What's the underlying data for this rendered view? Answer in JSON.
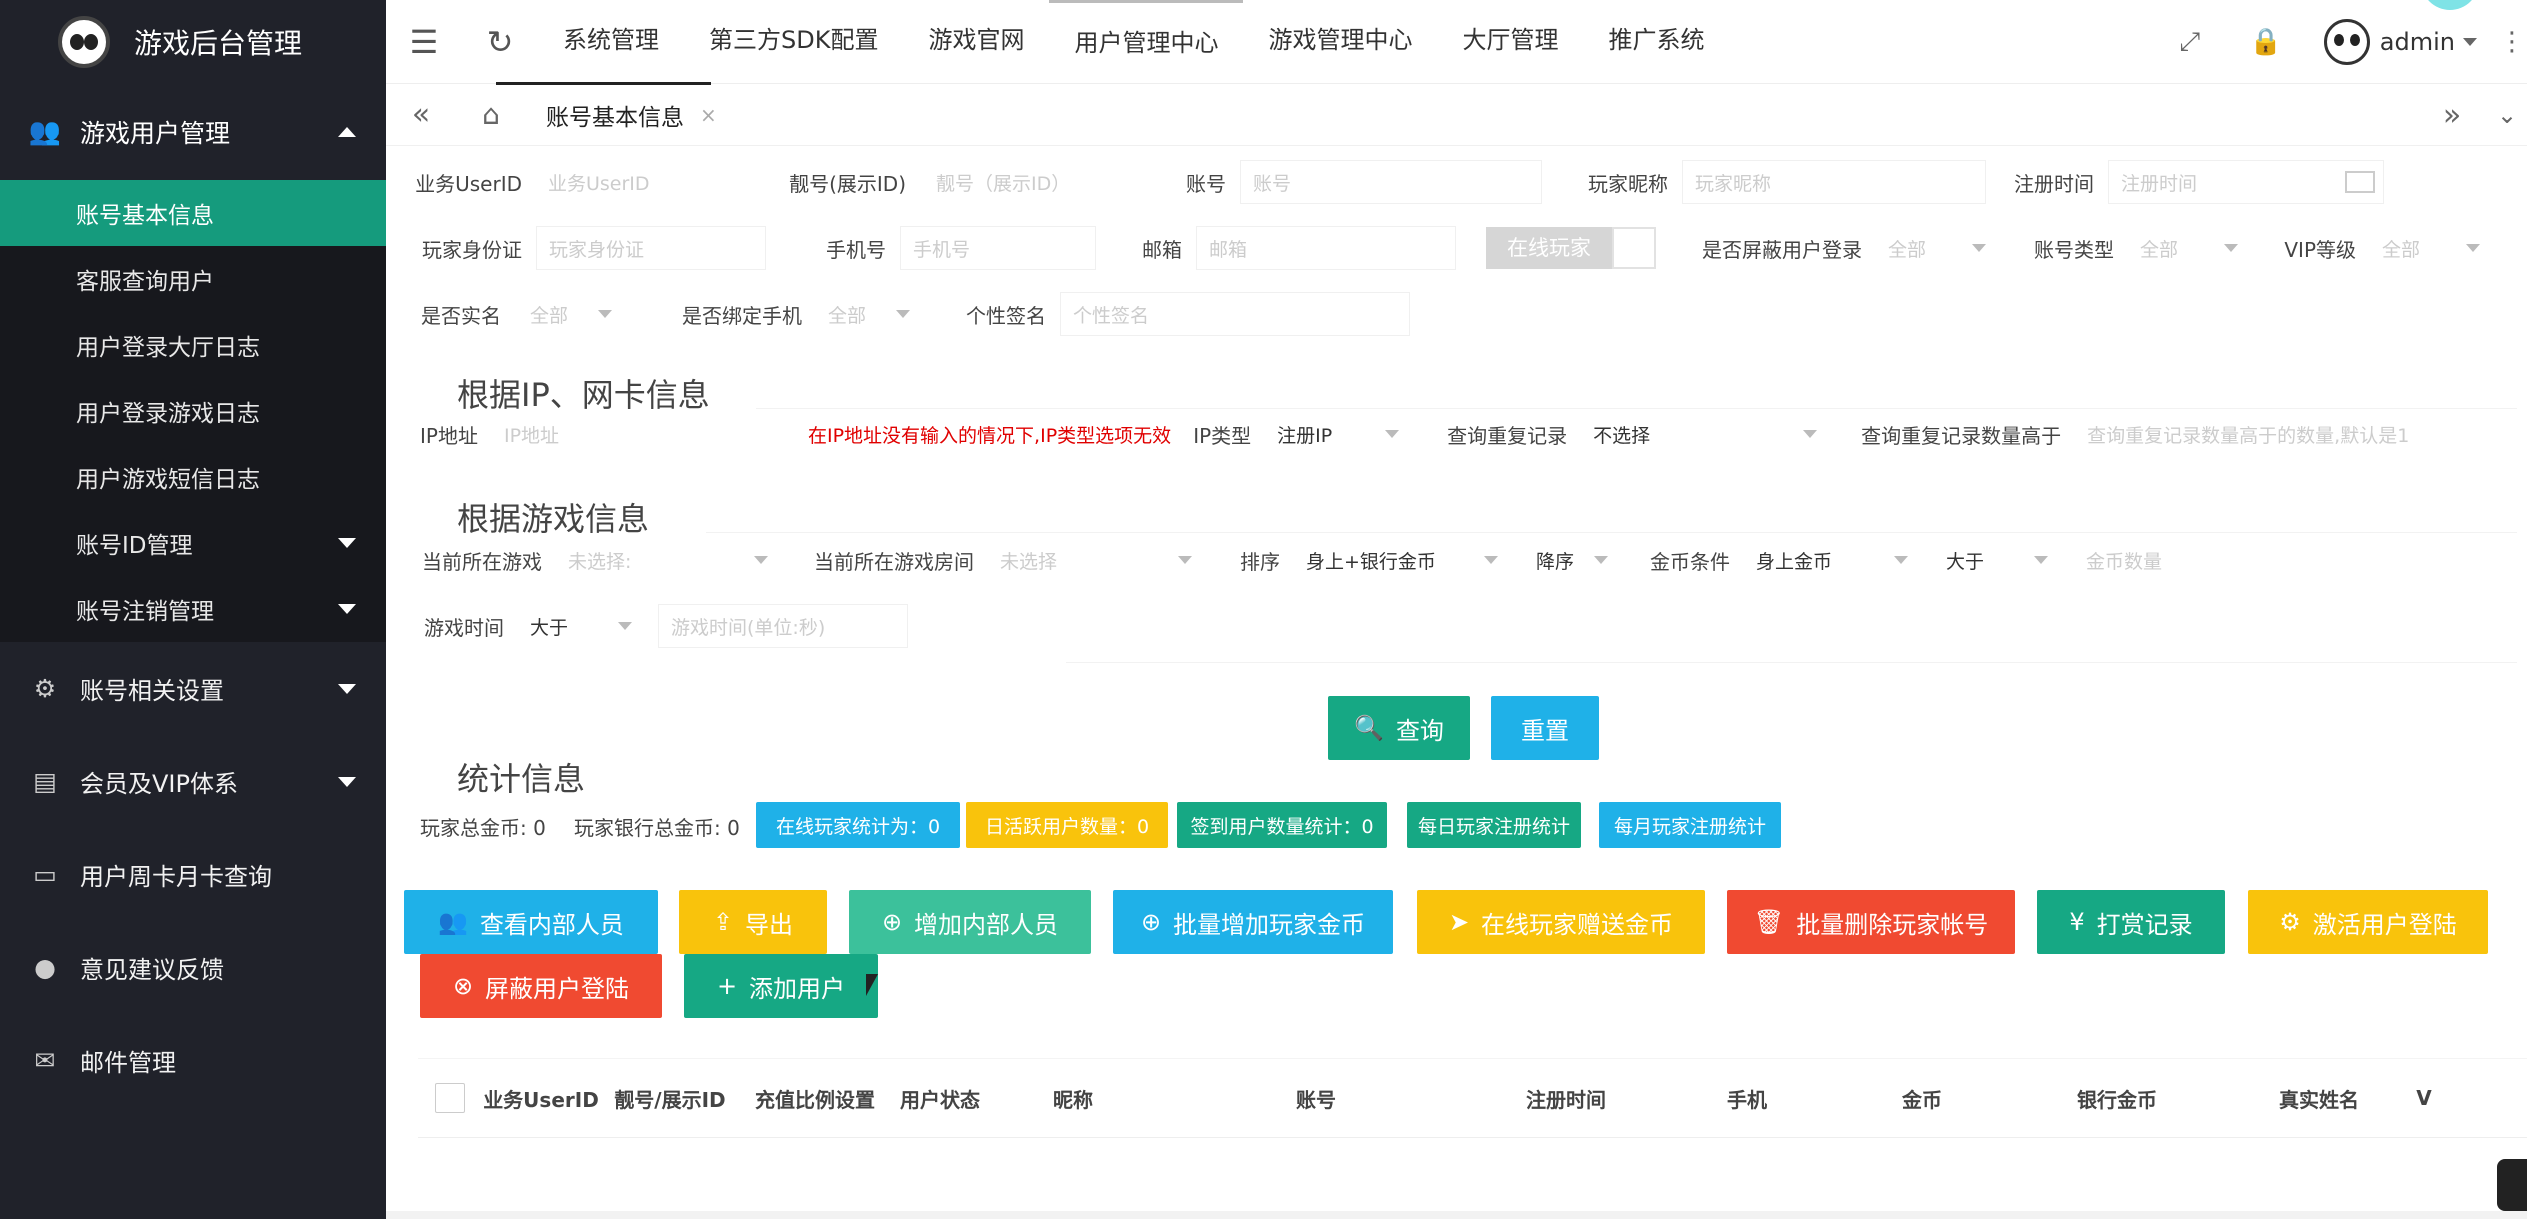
{
  "app": {
    "title": "游戏后台管理"
  },
  "sidebar": {
    "group_title": "游戏用户管理",
    "sub_items": [
      {
        "label": "账号基本信息",
        "active": true
      },
      {
        "label": "客服查询用户"
      },
      {
        "label": "用户登录大厅日志"
      },
      {
        "label": "用户登录游戏日志"
      },
      {
        "label": "用户游戏短信日志"
      },
      {
        "label": "账号ID管理",
        "caret": true
      },
      {
        "label": "账号注销管理",
        "caret": true
      }
    ],
    "items": [
      {
        "label": "账号相关设置",
        "icon": "gear-icon"
      },
      {
        "label": "会员及VIP体系",
        "icon": "vip-card-icon"
      },
      {
        "label": "用户周卡月卡查询",
        "icon": "card-icon"
      },
      {
        "label": "意见建议反馈",
        "icon": "chat-bubble-icon"
      },
      {
        "label": "邮件管理",
        "icon": "mail-icon"
      }
    ]
  },
  "header": {
    "nav": [
      "系统管理",
      "第三方SDK配置",
      "游戏官网",
      "用户管理中心",
      "游戏管理中心",
      "大厅管理",
      "推广系统"
    ],
    "user": "admin"
  },
  "tabs": {
    "active": "账号基本信息"
  },
  "filters": {
    "userid_label": "业务UserID",
    "userid_ph": "业务UserID",
    "pretty_label": "靓号(展示ID)",
    "pretty_ph": "靓号（展示ID）",
    "account_label": "账号",
    "account_ph": "账号",
    "nick_label": "玩家昵称",
    "nick_ph": "玩家昵称",
    "reg_label": "注册时间",
    "reg_ph": "注册时间",
    "idcard_label": "玩家身份证",
    "idcard_ph": "玩家身份证",
    "phone_label": "手机号",
    "phone_ph": "手机号",
    "email_label": "邮箱",
    "email_ph": "邮箱",
    "online_toggle": "在线玩家",
    "block_label": "是否屏蔽用户登录",
    "block_val": "全部",
    "acctype_label": "账号类型",
    "acctype_val": "全部",
    "vip_label": "VIP等级",
    "vip_val": "全部",
    "realname_label": "是否实名",
    "realname_val": "全部",
    "bindphone_label": "是否绑定手机",
    "bindphone_val": "全部",
    "sign_label": "个性签名",
    "sign_ph": "个性签名"
  },
  "ip_section": {
    "title": "根据IP、网卡信息",
    "ip_label": "IP地址",
    "ip_ph": "IP地址",
    "note": "在IP地址没有输入的情况下,IP类型选项无效",
    "iptype_label": "IP类型",
    "iptype_val": "注册IP",
    "dup_label": "查询重复记录",
    "dup_val": "不选择",
    "dupcount_label": "查询重复记录数量高于",
    "dupcount_ph": "查询重复记录数量高于的数量,默认是1"
  },
  "game_section": {
    "title": "根据游戏信息",
    "curgame_label": "当前所在游戏",
    "curgame_val": "未选择:",
    "curroom_label": "当前所在游戏房间",
    "curroom_val": "未选择",
    "sort_label": "排序",
    "sort_val": "身上+银行金币",
    "order_val": "降序",
    "gold_label": "金币条件",
    "gold_val": "身上金币",
    "cmp_val": "大于",
    "gold_ph": "金币数量",
    "time_label": "游戏时间",
    "time_cmp": "大于",
    "time_ph": "游戏时间(单位:秒)"
  },
  "actions": {
    "query": "查询",
    "reset": "重置"
  },
  "stats": {
    "title": "统计信息",
    "total_gold": "玩家总金币: 0",
    "bank_gold": "玩家银行总金币: 0",
    "online": "在线玩家统计为：0",
    "daily_active": "日活跃用户数量：0",
    "signin": "签到用户数量统计：0",
    "daily_reg": "每日玩家注册统计",
    "monthly_reg": "每月玩家注册统计"
  },
  "toolbar": [
    {
      "label": "查看内部人员",
      "color": "#1fb1e8",
      "icon": "users-icon"
    },
    {
      "label": "导出",
      "color": "#f9c30c",
      "icon": "export-icon"
    },
    {
      "label": "增加内部人员",
      "color": "#3cc19b",
      "icon": "plus-circle-icon"
    },
    {
      "label": "批量增加玩家金币",
      "color": "#1fb1e8",
      "icon": "plus-circle-icon"
    },
    {
      "label": "在线玩家赠送金币",
      "color": "#f9c30c",
      "icon": "send-icon"
    },
    {
      "label": "批量删除玩家帐号",
      "color": "#f04a31",
      "icon": "trash-icon"
    },
    {
      "label": "打赏记录",
      "color": "#16a884",
      "icon": "yen-icon"
    },
    {
      "label": "激活用户登陆",
      "color": "#f9c30c",
      "icon": "gear-icon"
    },
    {
      "label": "屏蔽用户登陆",
      "color": "#f04a31",
      "icon": "block-icon"
    },
    {
      "label": "添加用户",
      "color": "#16a884",
      "icon": "plus-icon"
    }
  ],
  "table": {
    "headers": [
      "业务UserID",
      "靓号/展示ID",
      "充值比例设置",
      "用户状态",
      "昵称",
      "账号",
      "注册时间",
      "手机",
      "金币",
      "银行金币",
      "真实姓名",
      "V"
    ]
  }
}
